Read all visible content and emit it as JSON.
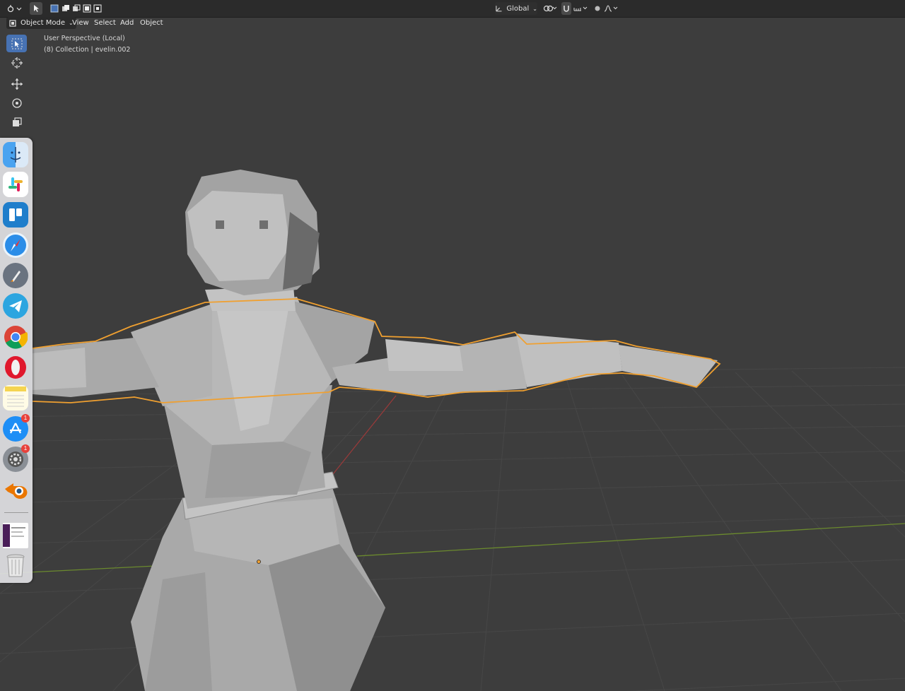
{
  "header": {
    "transform_orientation": "Global"
  },
  "menu": {
    "mode": "Object Mode",
    "items": [
      "View",
      "Select",
      "Add",
      "Object"
    ]
  },
  "viewport": {
    "view_name": "User Perspective (Local)",
    "collection_info": "(8) Collection | evelin.002"
  },
  "dock": {
    "apps": [
      {
        "name": "finder-icon"
      },
      {
        "name": "slack-icon"
      },
      {
        "name": "trello-icon"
      },
      {
        "name": "safari-icon"
      },
      {
        "name": "launchpad-icon"
      },
      {
        "name": "telegram-icon"
      },
      {
        "name": "chrome-icon"
      },
      {
        "name": "opera-icon"
      },
      {
        "name": "notes-icon"
      },
      {
        "name": "app-store-icon",
        "badge": "1"
      },
      {
        "name": "system-preferences-icon",
        "badge": "1"
      },
      {
        "name": "blender-icon"
      },
      {
        "name": "screenshot-thumbnail"
      },
      {
        "name": "trash-icon"
      }
    ]
  },
  "colors": {
    "background": "#3d3d3d",
    "header": "#2b2b2b",
    "active_tool": "#4772b3",
    "selection_outline": "#f0a030",
    "grid_line": "#4a4a4a",
    "x_axis": "#9a3a3a",
    "y_axis": "#6b8a2e"
  }
}
